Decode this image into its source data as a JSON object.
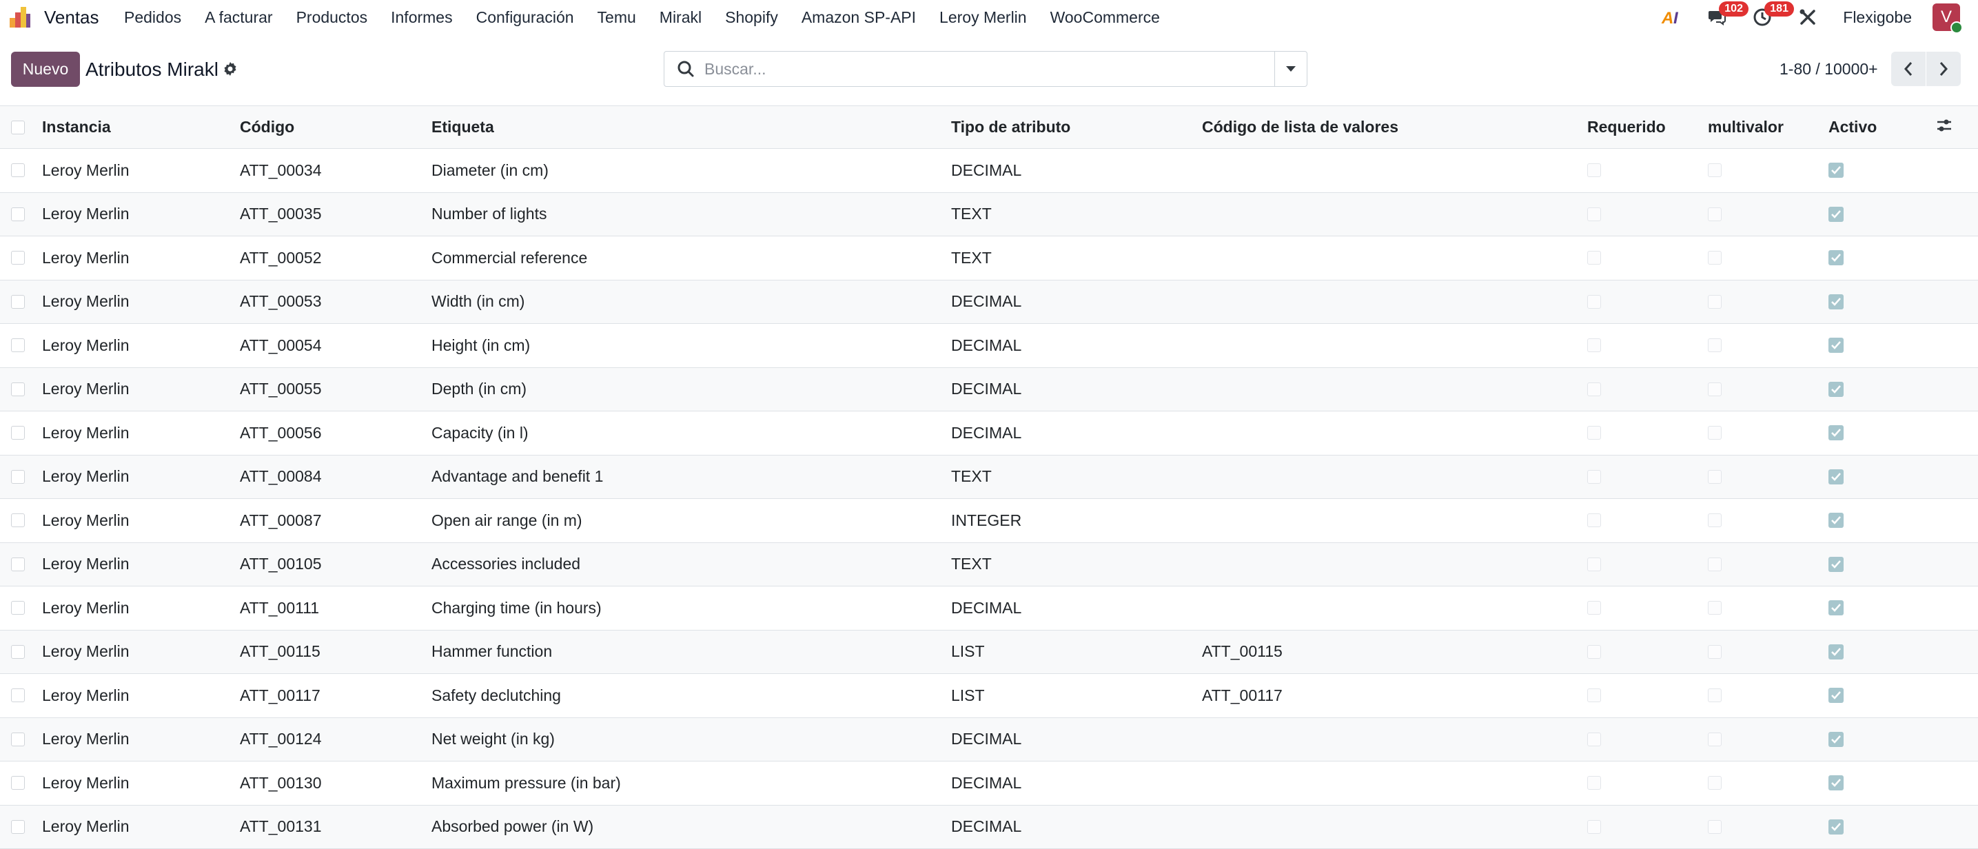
{
  "navbar": {
    "app_name": "Ventas",
    "menu": [
      "Pedidos",
      "A facturar",
      "Productos",
      "Informes",
      "Configuración",
      "Temu",
      "Mirakl",
      "Shopify",
      "Amazon SP-API",
      "Leroy Merlin",
      "WooCommerce"
    ],
    "messages_count": "102",
    "activities_count": "181",
    "company": "Flexigobe",
    "avatar_letter": "V"
  },
  "control": {
    "new_button": "Nuevo",
    "title": "Atributos Mirakl",
    "search_placeholder": "Buscar...",
    "pager": "1-80 / 10000+"
  },
  "table": {
    "headers": [
      "Instancia",
      "Código",
      "Etiqueta",
      "Tipo de atributo",
      "Código de lista de valores",
      "Requerido",
      "multivalor",
      "Activo"
    ],
    "rows": [
      {
        "instancia": "Leroy Merlin",
        "codigo": "ATT_00034",
        "etiqueta": "Diameter (in cm)",
        "tipo": "DECIMAL",
        "lista": "",
        "requerido": false,
        "multivalor": false,
        "activo": true
      },
      {
        "instancia": "Leroy Merlin",
        "codigo": "ATT_00035",
        "etiqueta": "Number of lights",
        "tipo": "TEXT",
        "lista": "",
        "requerido": false,
        "multivalor": false,
        "activo": true
      },
      {
        "instancia": "Leroy Merlin",
        "codigo": "ATT_00052",
        "etiqueta": "Commercial reference",
        "tipo": "TEXT",
        "lista": "",
        "requerido": false,
        "multivalor": false,
        "activo": true
      },
      {
        "instancia": "Leroy Merlin",
        "codigo": "ATT_00053",
        "etiqueta": "Width (in cm)",
        "tipo": "DECIMAL",
        "lista": "",
        "requerido": false,
        "multivalor": false,
        "activo": true
      },
      {
        "instancia": "Leroy Merlin",
        "codigo": "ATT_00054",
        "etiqueta": "Height (in cm)",
        "tipo": "DECIMAL",
        "lista": "",
        "requerido": false,
        "multivalor": false,
        "activo": true
      },
      {
        "instancia": "Leroy Merlin",
        "codigo": "ATT_00055",
        "etiqueta": "Depth (in cm)",
        "tipo": "DECIMAL",
        "lista": "",
        "requerido": false,
        "multivalor": false,
        "activo": true
      },
      {
        "instancia": "Leroy Merlin",
        "codigo": "ATT_00056",
        "etiqueta": "Capacity (in l)",
        "tipo": "DECIMAL",
        "lista": "",
        "requerido": false,
        "multivalor": false,
        "activo": true
      },
      {
        "instancia": "Leroy Merlin",
        "codigo": "ATT_00084",
        "etiqueta": "Advantage and benefit 1",
        "tipo": "TEXT",
        "lista": "",
        "requerido": false,
        "multivalor": false,
        "activo": true
      },
      {
        "instancia": "Leroy Merlin",
        "codigo": "ATT_00087",
        "etiqueta": "Open air range (in m)",
        "tipo": "INTEGER",
        "lista": "",
        "requerido": false,
        "multivalor": false,
        "activo": true
      },
      {
        "instancia": "Leroy Merlin",
        "codigo": "ATT_00105",
        "etiqueta": "Accessories included",
        "tipo": "TEXT",
        "lista": "",
        "requerido": false,
        "multivalor": false,
        "activo": true
      },
      {
        "instancia": "Leroy Merlin",
        "codigo": "ATT_00111",
        "etiqueta": "Charging time (in hours)",
        "tipo": "DECIMAL",
        "lista": "",
        "requerido": false,
        "multivalor": false,
        "activo": true
      },
      {
        "instancia": "Leroy Merlin",
        "codigo": "ATT_00115",
        "etiqueta": "Hammer function",
        "tipo": "LIST",
        "lista": "ATT_00115",
        "requerido": false,
        "multivalor": false,
        "activo": true
      },
      {
        "instancia": "Leroy Merlin",
        "codigo": "ATT_00117",
        "etiqueta": "Safety declutching",
        "tipo": "LIST",
        "lista": "ATT_00117",
        "requerido": false,
        "multivalor": false,
        "activo": true
      },
      {
        "instancia": "Leroy Merlin",
        "codigo": "ATT_00124",
        "etiqueta": "Net weight (in kg)",
        "tipo": "DECIMAL",
        "lista": "",
        "requerido": false,
        "multivalor": false,
        "activo": true
      },
      {
        "instancia": "Leroy Merlin",
        "codigo": "ATT_00130",
        "etiqueta": "Maximum pressure (in bar)",
        "tipo": "DECIMAL",
        "lista": "",
        "requerido": false,
        "multivalor": false,
        "activo": true
      },
      {
        "instancia": "Leroy Merlin",
        "codigo": "ATT_00131",
        "etiqueta": "Absorbed power (in W)",
        "tipo": "DECIMAL",
        "lista": "",
        "requerido": false,
        "multivalor": false,
        "activo": true
      }
    ]
  },
  "colors": {
    "brand": "#714b67",
    "badge": "#e03131",
    "avatar": "#b5384d",
    "checked": "#a7c6cd"
  }
}
